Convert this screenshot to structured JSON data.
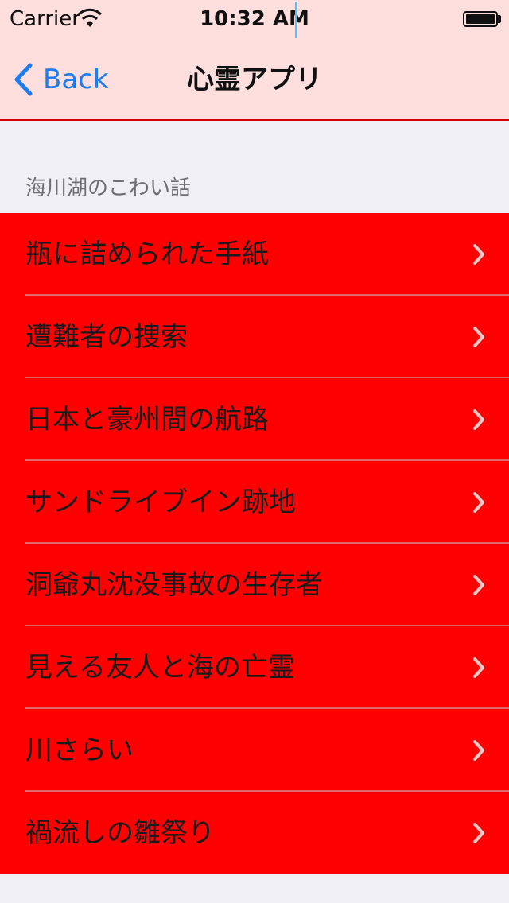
{
  "status_bar": {
    "carrier": "Carrier",
    "time": "10:32 AM",
    "battery_level": 1.0
  },
  "nav": {
    "back_label": "Back",
    "title": "心霊アプリ"
  },
  "section": {
    "header": "海川湖のこわい話"
  },
  "items": [
    {
      "label": "瓶に詰められた手紙"
    },
    {
      "label": "遭難者の捜索"
    },
    {
      "label": "日本と豪州間の航路"
    },
    {
      "label": "サンドライブイン跡地"
    },
    {
      "label": "洞爺丸沈没事故の生存者"
    },
    {
      "label": "見える友人と海の亡霊"
    },
    {
      "label": "川さらい"
    },
    {
      "label": "禍流しの雛祭り"
    }
  ],
  "colors": {
    "nav_background": "#ffdede",
    "nav_border": "#d40000",
    "row_background": "#ff0000",
    "back_tint": "#1c7cf4"
  },
  "icons": {
    "back": "chevron-left-icon",
    "row": "chevron-right-icon",
    "wifi": "wifi-icon",
    "battery": "battery-icon"
  }
}
